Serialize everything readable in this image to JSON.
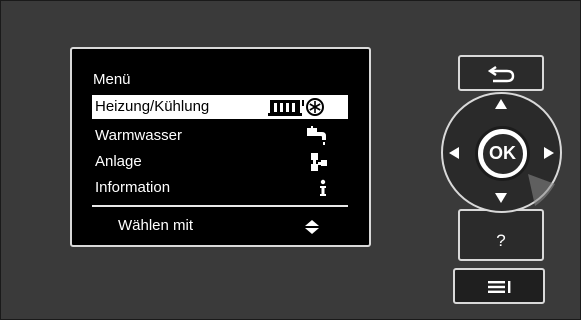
{
  "menu": {
    "title": "Menü",
    "items": [
      {
        "label": "Heizung/Kühlung",
        "icon": "radiator-snowflake-icon",
        "selected": true
      },
      {
        "label": "Warmwasser",
        "icon": "tap-icon",
        "selected": false
      },
      {
        "label": "Anlage",
        "icon": "system-icon",
        "selected": false
      },
      {
        "label": "Information",
        "icon": "info-icon",
        "selected": false
      }
    ],
    "hint": "Wählen mit",
    "hint_icon": "up-down-arrows-icon"
  },
  "keys": {
    "back_icon": "back-arrow-icon",
    "ok_label": "OK",
    "help_label": "?",
    "menu_icon": "menu-list-icon"
  },
  "colors": {
    "panel": "#3a3a3a",
    "screen": "#000000",
    "highlight": "#ffffff",
    "border": "#d9d9d9"
  }
}
